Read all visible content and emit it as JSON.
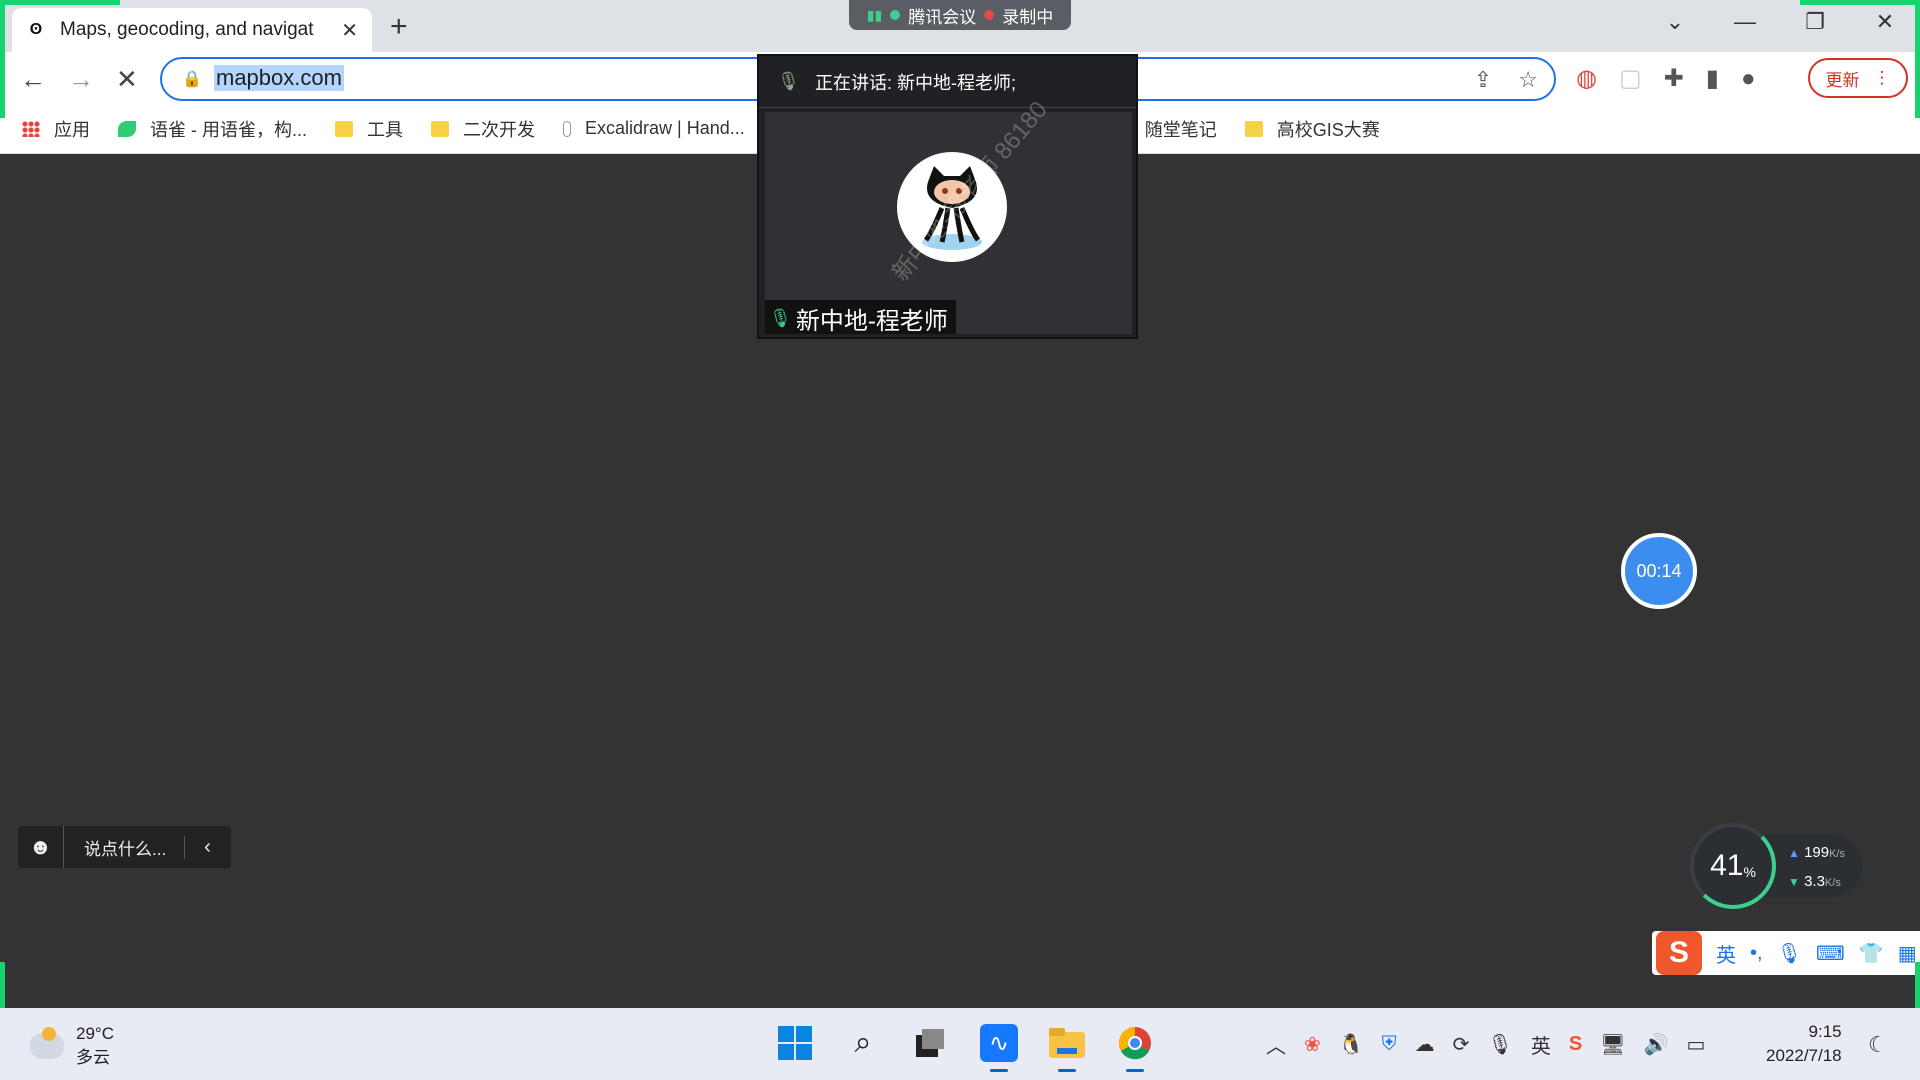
{
  "browser": {
    "tab": {
      "title": "Maps, geocoding, and navigat",
      "favicon": "mapbox-icon"
    },
    "new_tab": "+",
    "url": "mapbox.com",
    "update_label": "更新",
    "bookmarks": [
      {
        "label": "应用",
        "icon": "apps-grid-icon"
      },
      {
        "label": "语雀 - 用语雀，构...",
        "icon": "yuque-icon"
      },
      {
        "label": "工具",
        "icon": "folder-icon"
      },
      {
        "label": "二次开发",
        "icon": "folder-icon"
      },
      {
        "label": "Excalidraw | Hand...",
        "icon": "excalidraw-icon"
      },
      {
        "label": "随堂笔记",
        "icon": "folder-icon"
      },
      {
        "label": "高校GIS大赛",
        "icon": "folder-icon"
      }
    ]
  },
  "meeting": {
    "app_name": "腾讯会议",
    "recording": "录制中",
    "speaking_label": "正在讲话: 新中地-程老师;",
    "speaker_name": "新中地-程老师",
    "watermark": "新中地-程老师 86180",
    "timer": "00:14"
  },
  "chat": {
    "placeholder": "说点什么..."
  },
  "netmeter": {
    "percent": "41",
    "unit": "%",
    "upload": "199",
    "download": "3.3",
    "speed_unit": "K/s"
  },
  "ime": {
    "mode": "英",
    "punct": "•,"
  },
  "taskbar": {
    "weather": {
      "temp": "29°C",
      "desc": "多云"
    },
    "ime_indicator": "英",
    "time": "9:15",
    "date": "2022/7/18"
  }
}
